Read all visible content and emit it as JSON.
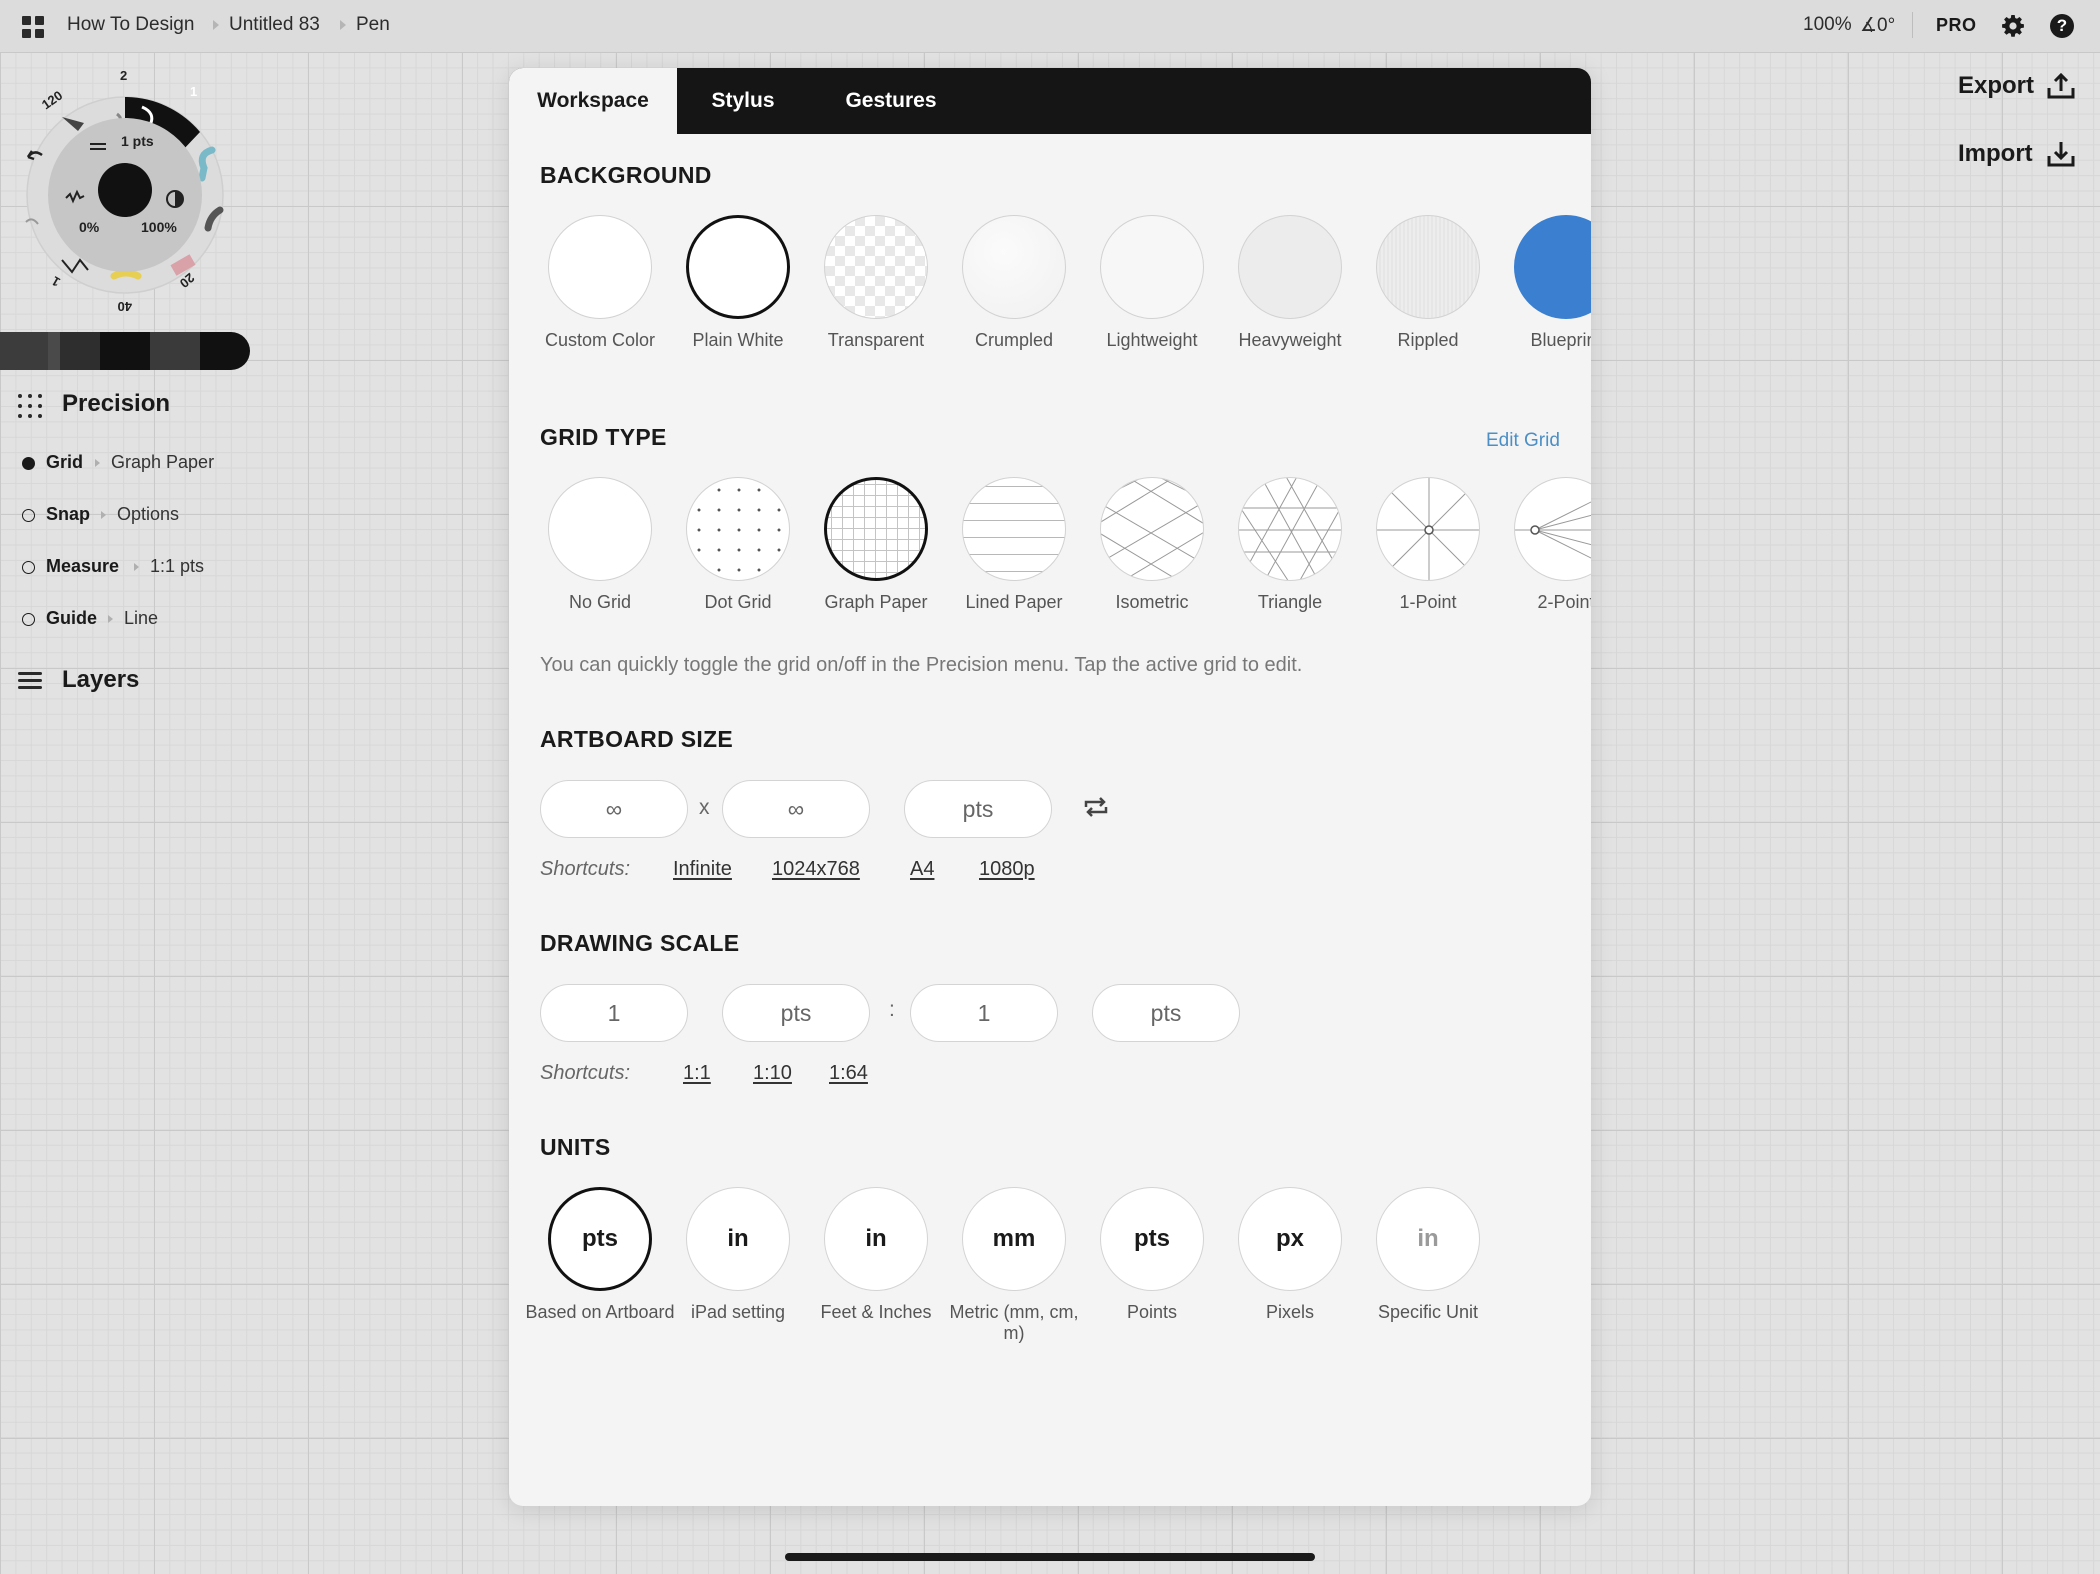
{
  "topbar": {
    "crumbs": [
      "How To Design",
      "Untitled 83",
      "Pen"
    ],
    "zoom": "100%",
    "angle": "∡0°",
    "pro_label": "PRO",
    "icons": [
      "apps-grid-icon",
      "gear-icon",
      "help-icon"
    ]
  },
  "side_actions": {
    "export_label": "Export",
    "import_label": "Import"
  },
  "brush_wheel": {
    "size_label": "1 pts",
    "opacity_label": "0%",
    "smoothing_label": "100%",
    "presets": [
      "120",
      "2",
      "1",
      "40",
      "20",
      "1"
    ]
  },
  "precision": {
    "title": "Precision",
    "rows": [
      {
        "name": "Grid",
        "value": "Graph Paper",
        "active": true
      },
      {
        "name": "Snap",
        "value": "Options",
        "active": false
      },
      {
        "name": "Measure",
        "value": "1:1 pts",
        "active": false
      },
      {
        "name": "Guide",
        "value": "Line",
        "active": false
      }
    ],
    "layers_title": "Layers"
  },
  "modal": {
    "tabs": [
      "Workspace",
      "Stylus",
      "Gestures"
    ],
    "active_tab": "Workspace",
    "background": {
      "title": "BACKGROUND",
      "options": [
        "Custom Color",
        "Plain White",
        "Transparent",
        "Crumpled",
        "Lightweight",
        "Heavyweight",
        "Rippled",
        "Blueprint"
      ],
      "selected": "Plain White",
      "blueprint_color": "#3a7fd0"
    },
    "grid_type": {
      "title": "GRID TYPE",
      "edit_label": "Edit Grid",
      "options": [
        "No Grid",
        "Dot Grid",
        "Graph Paper",
        "Lined Paper",
        "Isometric",
        "Triangle",
        "1-Point",
        "2-Point"
      ],
      "selected": "Graph Paper",
      "hint": "You can quickly toggle the grid on/off in the Precision menu. Tap the active grid to edit."
    },
    "artboard": {
      "title": "ARTBOARD SIZE",
      "width": "∞",
      "height": "∞",
      "x_label": "x",
      "unit": "pts",
      "shortcuts_label": "Shortcuts:",
      "shortcuts": [
        "Infinite",
        "1024x768",
        "A4",
        "1080p"
      ]
    },
    "drawing_scale": {
      "title": "DRAWING SCALE",
      "left_value": "1",
      "left_unit": "pts",
      "colon": ":",
      "right_value": "1",
      "right_unit": "pts",
      "shortcuts_label": "Shortcuts:",
      "shortcuts": [
        "1:1",
        "1:10",
        "1:64"
      ]
    },
    "units": {
      "title": "UNITS",
      "options": [
        {
          "symbol": "pts",
          "label": "Based on Artboard"
        },
        {
          "symbol": "in",
          "label": "iPad setting"
        },
        {
          "symbol": "in",
          "label": "Feet & Inches"
        },
        {
          "symbol": "mm",
          "label": "Metric (mm, cm, m)"
        },
        {
          "symbol": "pts",
          "label": "Points"
        },
        {
          "symbol": "px",
          "label": "Pixels"
        },
        {
          "symbol": "in",
          "label": "Specific Unit"
        }
      ],
      "selected": "Based on Artboard"
    }
  }
}
